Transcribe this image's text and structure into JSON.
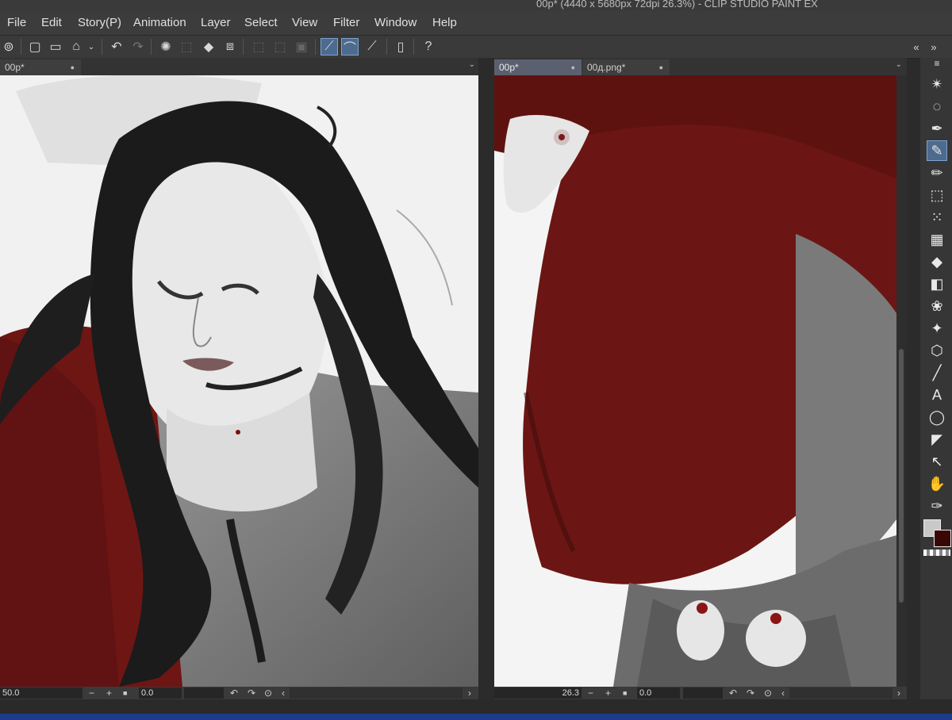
{
  "title": "00р* (4440 x 5680px 72dpi 26.3%)  - CLIP STUDIO PAINT EX",
  "menu": [
    "File",
    "Edit",
    "Story(P)",
    "Animation",
    "Layer",
    "Select",
    "View",
    "Filter",
    "Window",
    "Help"
  ],
  "left_view": {
    "tab_label": "00р*",
    "zoom": "50.0",
    "rotation": "0.0"
  },
  "right_view": {
    "tabs": [
      "00р*",
      "00д.png*"
    ],
    "zoom": "26.3",
    "rotation": "0.0"
  },
  "colors": {
    "accent": "#4d6a8f",
    "cloak_red": "#6b1312",
    "main_color": "#c9c9c9",
    "sub_color": "#3a0707"
  },
  "toolbar_icons": [
    "app-logo-icon",
    "new-canvas-icon",
    "open-folder-icon",
    "save-icon",
    "undo-icon",
    "redo-icon",
    "spinner-icon",
    "clear-selection-icon",
    "fill-icon",
    "transform-icon",
    "hide-selection-icon",
    "invert-selection-icon",
    "grid-icon",
    "snap-ruler-icon",
    "snap-special-ruler-icon",
    "snap-grid-icon",
    "smartphone-icon",
    "help-icon"
  ],
  "tools": [
    "magic-wand-icon",
    "lasso-icon",
    "pen-nib-icon",
    "pencil-nib-icon",
    "pencil-icon",
    "eraser-icon",
    "spray-icon",
    "grid-tool-icon",
    "fill-bucket-icon",
    "gradient-icon",
    "blend-icon",
    "sparkle-icon",
    "3d-icon",
    "line-icon",
    "text-icon",
    "speech-balloon-icon",
    "frame-icon",
    "correct-line-icon",
    "hand-icon",
    "eyedropper-icon"
  ]
}
